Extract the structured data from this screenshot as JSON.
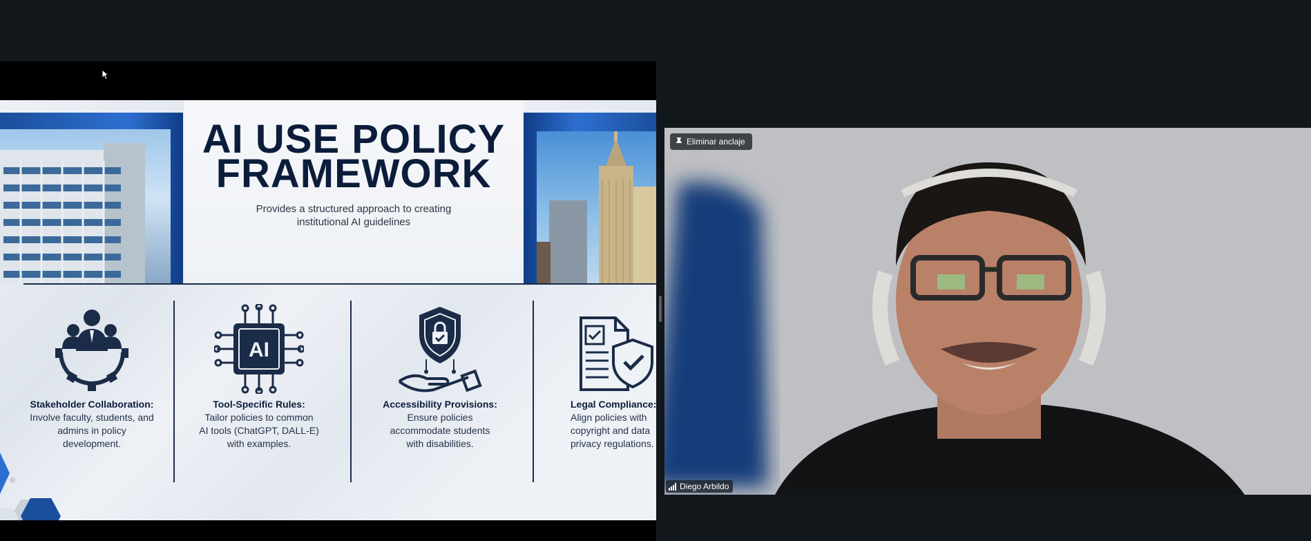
{
  "slide": {
    "title_line1": "AI USE POLICY",
    "title_line2": "FRAMEWORK",
    "subtitle_line1": "Provides a structured approach to creating",
    "subtitle_line2": "institutional AI guidelines",
    "features": [
      {
        "icon": "team-gear-icon",
        "heading": "Stakeholder Collaboration:",
        "desc_lines": [
          "Involve faculty, students, and",
          "admins in policy",
          "development."
        ]
      },
      {
        "icon": "ai-chip-icon",
        "heading": "Tool-Specific Rules:",
        "desc_lines": [
          "Tailor policies to common",
          "AI tools (ChatGPT, DALL-E)",
          "with examples."
        ]
      },
      {
        "icon": "hand-shield-lock-icon",
        "heading": "Accessibility Provisions:",
        "desc_lines": [
          "Ensure policies",
          "accommodate students",
          "with disabilities."
        ]
      },
      {
        "icon": "document-shield-icon",
        "heading": "Legal Compliance:",
        "desc_lines": [
          "Align policies with",
          "copyright and data",
          "privacy regulations."
        ]
      }
    ]
  },
  "video": {
    "pin_label": "Eliminar anclaje",
    "participant_name": "Diego Arbildo"
  },
  "colors": {
    "background": "#12171c",
    "navy": "#0b1d3a",
    "accent_blue": "#2d6fd0"
  }
}
